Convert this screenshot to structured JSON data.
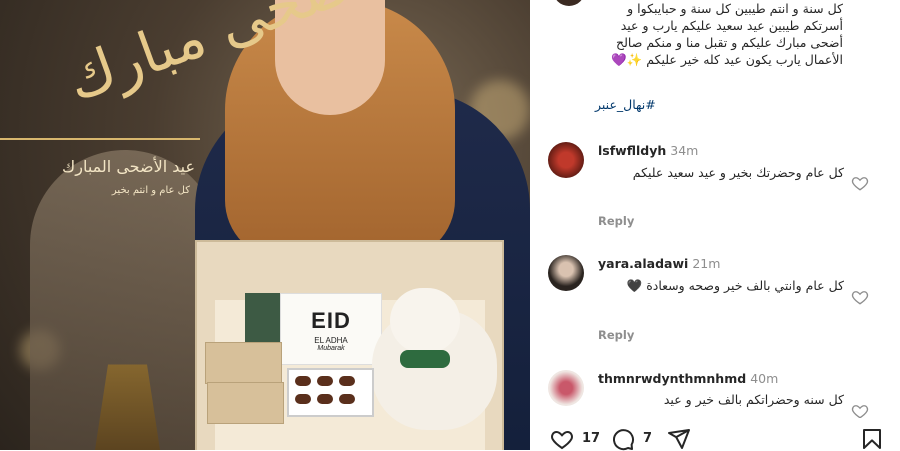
{
  "post_image": {
    "calligraphy": "أضحى مبارك",
    "eid_title": "عيد الأضحى المبارك",
    "eid_subtitle": "كل عام و انتم بخير",
    "card_big": "EID",
    "card_small": "EL ADHA",
    "card_script": "Mubarak"
  },
  "caption": {
    "text": "كل سنة و انتم طيبين كل سنة و حبايبكوا و أسرتكم طيبين عيد سعيد عليكم يارب و عيد أضحى مبارك عليكم و تقبل منا و منكم صالح الأعمال يارب يكون عيد كله خير عليكم ✨💜",
    "hashtag": "#نهال_عنبر"
  },
  "comments": [
    {
      "username": "lsfwflldyh",
      "time": "34m",
      "text": "كل عام وحضرتك بخير و عيد سعيد عليكم",
      "reply": "Reply"
    },
    {
      "username": "yara.aladawi",
      "time": "21m",
      "text": "كل عام وانتي بالف خير وصحه وسعادة 🖤",
      "reply": "Reply"
    },
    {
      "username": "thmnrwdynthmnhmd",
      "time": "40m",
      "text": "كل سنه وحضراتكم بالف خير و عيد"
    }
  ],
  "actions": {
    "likes": "17",
    "comments": "7"
  },
  "icons": [
    "heart-icon",
    "comment-icon",
    "share-icon",
    "bookmark-icon"
  ]
}
